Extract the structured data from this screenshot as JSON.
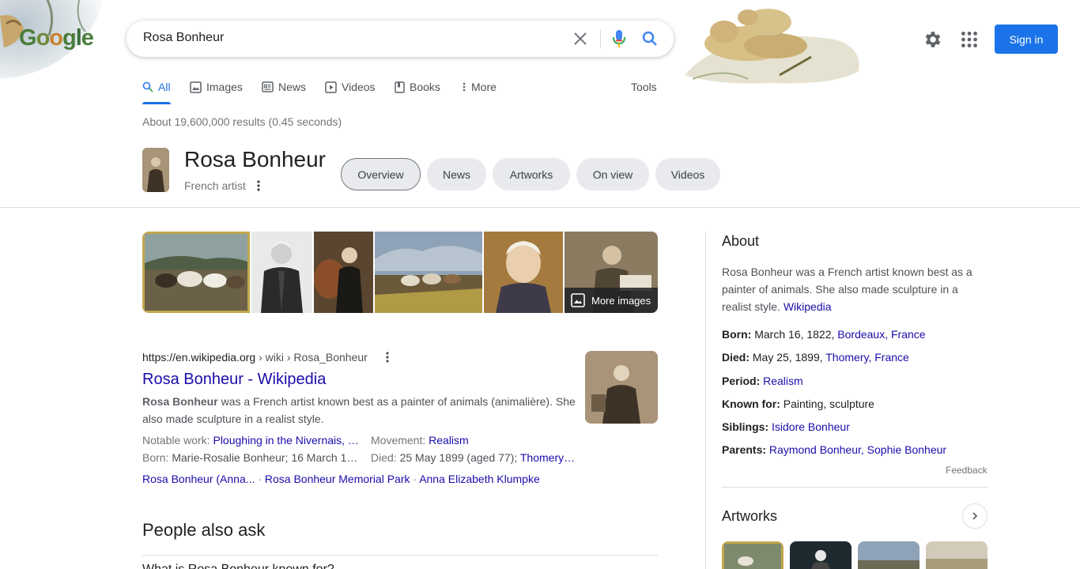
{
  "logo": {
    "text": "Google"
  },
  "search": {
    "query": "Rosa Bonheur"
  },
  "header": {
    "signin_label": "Sign in"
  },
  "tabs": [
    {
      "label": "All",
      "icon": "search-icon"
    },
    {
      "label": "Images",
      "icon": "image-icon"
    },
    {
      "label": "News",
      "icon": "news-icon"
    },
    {
      "label": "Videos",
      "icon": "play-icon"
    },
    {
      "label": "Books",
      "icon": "book-icon"
    },
    {
      "label": "More",
      "icon": "more-vert-icon"
    }
  ],
  "tools_label": "Tools",
  "result_stats": "About 19,600,000 results (0.45 seconds)",
  "entity": {
    "title": "Rosa Bonheur",
    "subtitle": "French artist",
    "chips": [
      "Overview",
      "News",
      "Artworks",
      "On view",
      "Videos"
    ]
  },
  "more_images_label": "More images",
  "wiki_result": {
    "domain": "https://en.wikipedia.org",
    "path": " › wiki › Rosa_Bonheur",
    "title": "Rosa Bonheur - Wikipedia",
    "snippet_bold": "Rosa Bonheur",
    "snippet_rest": " was a French artist known best as a painter of animals (animalière). She also made sculpture in a realist style.",
    "notable_label": "Notable work: ",
    "notable_value": "Ploughing in the Nivernais, …",
    "movement_label": "Movement: ",
    "movement_value": "Realism",
    "born_label": "Born: ",
    "born_value": "Marie-Rosalie Bonheur; 16 March 1…",
    "died_label": "Died: ",
    "died_value": "25 May 1899 (aged 77); ",
    "died_link": "Thomery…",
    "sitelinks": [
      "Rosa Bonheur (Anna...",
      "Rosa Bonheur Memorial Park",
      "Anna Elizabeth Klumpke"
    ],
    "sitelink_sep": " · "
  },
  "paa": {
    "title": "People also ask",
    "first_question": "What is Rosa Bonheur known for?"
  },
  "knowledge_panel": {
    "about_title": "About",
    "description": "Rosa Bonheur was a French artist known best as a painter of animals. She also made sculpture in a realist style. ",
    "description_link": "Wikipedia",
    "facts": [
      {
        "label": "Born:",
        "text": " March 16, 1822, ",
        "link": "Bordeaux, France"
      },
      {
        "label": "Died:",
        "text": " May 25, 1899, ",
        "link": "Thomery, France"
      },
      {
        "label": "Period:",
        "text": " ",
        "link": "Realism"
      },
      {
        "label": "Known for:",
        "text": " Painting, sculpture",
        "link": ""
      },
      {
        "label": "Siblings:",
        "text": " ",
        "link": "Isidore Bonheur"
      },
      {
        "label": "Parents:",
        "text": " ",
        "link": "Raymond Bonheur, Sophie Bonheur"
      }
    ],
    "feedback_label": "Feedback",
    "artworks_title": "Artworks"
  },
  "colors": {
    "accent": "#1a73e8",
    "link": "#1a0dab",
    "text": "#202124",
    "muted": "#70757a"
  }
}
